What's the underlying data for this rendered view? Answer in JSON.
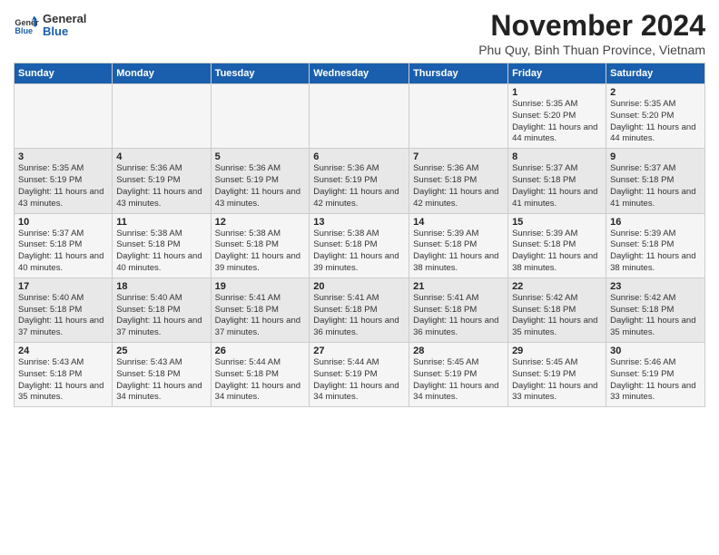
{
  "logo": {
    "general": "General",
    "blue": "Blue"
  },
  "title": "November 2024",
  "subtitle": "Phu Quy, Binh Thuan Province, Vietnam",
  "days_of_week": [
    "Sunday",
    "Monday",
    "Tuesday",
    "Wednesday",
    "Thursday",
    "Friday",
    "Saturday"
  ],
  "weeks": [
    [
      {
        "day": "",
        "info": ""
      },
      {
        "day": "",
        "info": ""
      },
      {
        "day": "",
        "info": ""
      },
      {
        "day": "",
        "info": ""
      },
      {
        "day": "",
        "info": ""
      },
      {
        "day": "1",
        "info": "Sunrise: 5:35 AM\nSunset: 5:20 PM\nDaylight: 11 hours and 44 minutes."
      },
      {
        "day": "2",
        "info": "Sunrise: 5:35 AM\nSunset: 5:20 PM\nDaylight: 11 hours and 44 minutes."
      }
    ],
    [
      {
        "day": "3",
        "info": "Sunrise: 5:35 AM\nSunset: 5:19 PM\nDaylight: 11 hours and 43 minutes."
      },
      {
        "day": "4",
        "info": "Sunrise: 5:36 AM\nSunset: 5:19 PM\nDaylight: 11 hours and 43 minutes."
      },
      {
        "day": "5",
        "info": "Sunrise: 5:36 AM\nSunset: 5:19 PM\nDaylight: 11 hours and 43 minutes."
      },
      {
        "day": "6",
        "info": "Sunrise: 5:36 AM\nSunset: 5:19 PM\nDaylight: 11 hours and 42 minutes."
      },
      {
        "day": "7",
        "info": "Sunrise: 5:36 AM\nSunset: 5:18 PM\nDaylight: 11 hours and 42 minutes."
      },
      {
        "day": "8",
        "info": "Sunrise: 5:37 AM\nSunset: 5:18 PM\nDaylight: 11 hours and 41 minutes."
      },
      {
        "day": "9",
        "info": "Sunrise: 5:37 AM\nSunset: 5:18 PM\nDaylight: 11 hours and 41 minutes."
      }
    ],
    [
      {
        "day": "10",
        "info": "Sunrise: 5:37 AM\nSunset: 5:18 PM\nDaylight: 11 hours and 40 minutes."
      },
      {
        "day": "11",
        "info": "Sunrise: 5:38 AM\nSunset: 5:18 PM\nDaylight: 11 hours and 40 minutes."
      },
      {
        "day": "12",
        "info": "Sunrise: 5:38 AM\nSunset: 5:18 PM\nDaylight: 11 hours and 39 minutes."
      },
      {
        "day": "13",
        "info": "Sunrise: 5:38 AM\nSunset: 5:18 PM\nDaylight: 11 hours and 39 minutes."
      },
      {
        "day": "14",
        "info": "Sunrise: 5:39 AM\nSunset: 5:18 PM\nDaylight: 11 hours and 38 minutes."
      },
      {
        "day": "15",
        "info": "Sunrise: 5:39 AM\nSunset: 5:18 PM\nDaylight: 11 hours and 38 minutes."
      },
      {
        "day": "16",
        "info": "Sunrise: 5:39 AM\nSunset: 5:18 PM\nDaylight: 11 hours and 38 minutes."
      }
    ],
    [
      {
        "day": "17",
        "info": "Sunrise: 5:40 AM\nSunset: 5:18 PM\nDaylight: 11 hours and 37 minutes."
      },
      {
        "day": "18",
        "info": "Sunrise: 5:40 AM\nSunset: 5:18 PM\nDaylight: 11 hours and 37 minutes."
      },
      {
        "day": "19",
        "info": "Sunrise: 5:41 AM\nSunset: 5:18 PM\nDaylight: 11 hours and 37 minutes."
      },
      {
        "day": "20",
        "info": "Sunrise: 5:41 AM\nSunset: 5:18 PM\nDaylight: 11 hours and 36 minutes."
      },
      {
        "day": "21",
        "info": "Sunrise: 5:41 AM\nSunset: 5:18 PM\nDaylight: 11 hours and 36 minutes."
      },
      {
        "day": "22",
        "info": "Sunrise: 5:42 AM\nSunset: 5:18 PM\nDaylight: 11 hours and 35 minutes."
      },
      {
        "day": "23",
        "info": "Sunrise: 5:42 AM\nSunset: 5:18 PM\nDaylight: 11 hours and 35 minutes."
      }
    ],
    [
      {
        "day": "24",
        "info": "Sunrise: 5:43 AM\nSunset: 5:18 PM\nDaylight: 11 hours and 35 minutes."
      },
      {
        "day": "25",
        "info": "Sunrise: 5:43 AM\nSunset: 5:18 PM\nDaylight: 11 hours and 34 minutes."
      },
      {
        "day": "26",
        "info": "Sunrise: 5:44 AM\nSunset: 5:18 PM\nDaylight: 11 hours and 34 minutes."
      },
      {
        "day": "27",
        "info": "Sunrise: 5:44 AM\nSunset: 5:19 PM\nDaylight: 11 hours and 34 minutes."
      },
      {
        "day": "28",
        "info": "Sunrise: 5:45 AM\nSunset: 5:19 PM\nDaylight: 11 hours and 34 minutes."
      },
      {
        "day": "29",
        "info": "Sunrise: 5:45 AM\nSunset: 5:19 PM\nDaylight: 11 hours and 33 minutes."
      },
      {
        "day": "30",
        "info": "Sunrise: 5:46 AM\nSunset: 5:19 PM\nDaylight: 11 hours and 33 minutes."
      }
    ]
  ]
}
